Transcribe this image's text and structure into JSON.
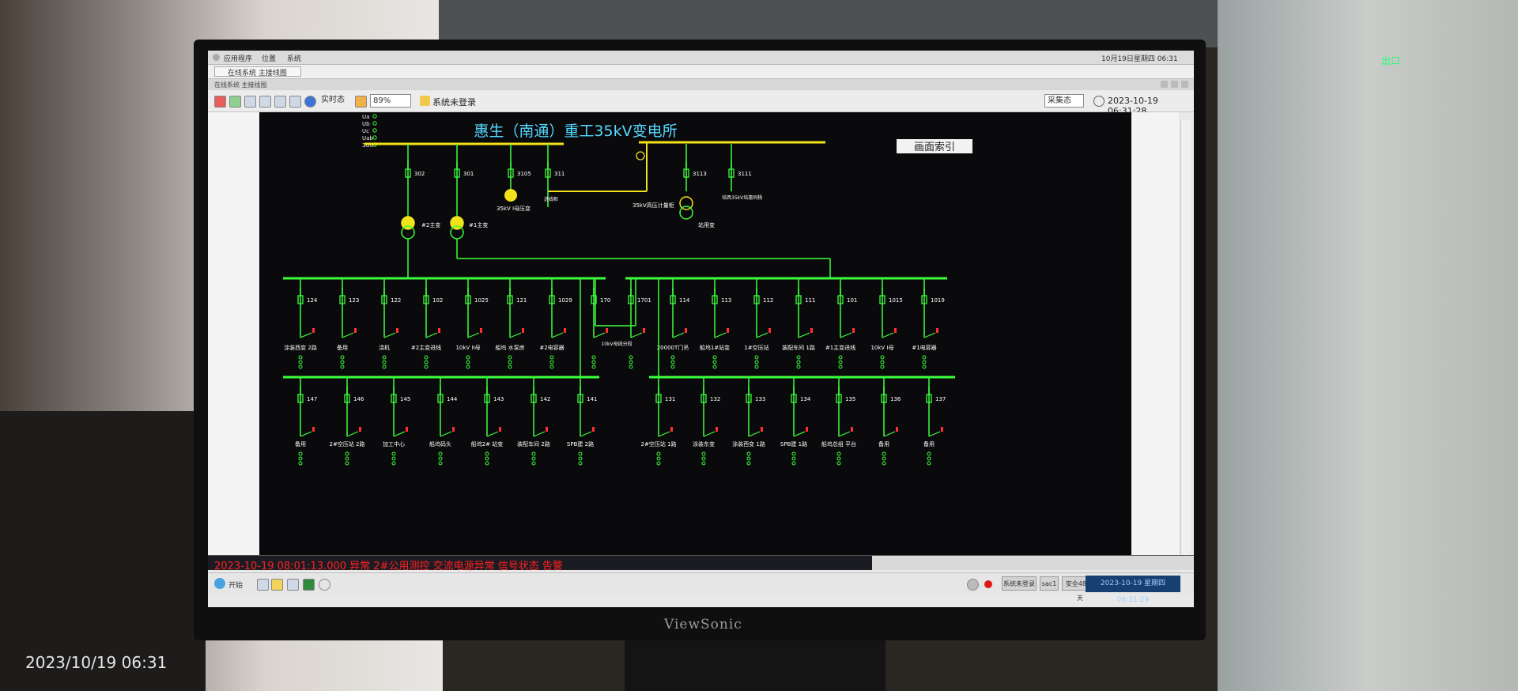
{
  "photo_timestamp": "2023/10/19 06:31",
  "monitor_brand": "ViewSonic",
  "exit_sign": "出口",
  "os_bar": {
    "menu": [
      "应用程序",
      "位置",
      "系统"
    ],
    "clock": "10月19日星期四 06:31"
  },
  "tab_bar": {
    "tab": "在线系统 主接线图"
  },
  "window_title": "在线系统 主接线图",
  "toolbar": {
    "mode": "实时态",
    "zoom": "89%",
    "login_status": "系统未登录",
    "collect_mode": "采集态",
    "datetime": "2023-10-19 06:31:28"
  },
  "diagram": {
    "title": "惠生（南通）重工35kV变电所",
    "index_button": "画面索引",
    "voltage_labels": [
      "Ua",
      "Ub",
      "Uc",
      "Uab",
      "3U0"
    ],
    "hv": {
      "breakers": [
        "302",
        "301",
        "3105",
        "311",
        "3113",
        "3111"
      ],
      "labels": {
        "t2": "#2主变",
        "t1": "#1主变",
        "pt35": "35kV I母压变",
        "feed": "进线柜",
        "meter": "35kV高压计量柜",
        "station": "站用变",
        "line": "培西35kV培惠同杨"
      }
    },
    "bus1_upper": [
      {
        "no": "124",
        "label": "涂装西变 2路"
      },
      {
        "no": "123",
        "label": "备用"
      },
      {
        "no": "122",
        "label": "浇机"
      },
      {
        "no": "102",
        "label": "#2主变进线"
      },
      {
        "no": "1025",
        "label": "10kV II母"
      },
      {
        "no": "121",
        "label": "船坞 水泵房"
      },
      {
        "no": "1029",
        "label": "#2电容器"
      },
      {
        "no": "170",
        "label": ""
      }
    ],
    "bus_tie_label": "10kV母线分段",
    "bus2_upper": [
      {
        "no": "1701",
        "label": ""
      },
      {
        "no": "114",
        "label": "20000T门吊"
      },
      {
        "no": "113",
        "label": "船坞1#站变"
      },
      {
        "no": "112",
        "label": "1#空压站"
      },
      {
        "no": "111",
        "label": "装配车间 1路"
      },
      {
        "no": "101",
        "label": "#1主变进线"
      },
      {
        "no": "1015",
        "label": "10kV I母"
      },
      {
        "no": "1019",
        "label": "#1电容器"
      }
    ],
    "bus1_lower": [
      {
        "no": "147",
        "label": "备用"
      },
      {
        "no": "146",
        "label": "2#空压站 2路"
      },
      {
        "no": "145",
        "label": "加工中心"
      },
      {
        "no": "144",
        "label": "船坞码头"
      },
      {
        "no": "143",
        "label": "船坞2# 站变"
      },
      {
        "no": "142",
        "label": "装配车间 2路"
      },
      {
        "no": "141",
        "label": "SPB建 2路"
      }
    ],
    "bus2_lower": [
      {
        "no": "131",
        "label": "2#空压站 1路"
      },
      {
        "no": "132",
        "label": "涂装东变"
      },
      {
        "no": "133",
        "label": "涂装西变 1路"
      },
      {
        "no": "134",
        "label": "SPB建 1路"
      },
      {
        "no": "135",
        "label": "船坞总组 平台"
      },
      {
        "no": "136",
        "label": "备用"
      },
      {
        "no": "137",
        "label": "备用"
      }
    ]
  },
  "alarm": {
    "text": "2023-10-19 08:01:13.000  异常  2#公用测控  交流电源异常  信号状态  告警"
  },
  "taskbar": {
    "start": "开始",
    "user": "系统未登录",
    "node": "sac1",
    "uptime": "安全4858天",
    "clock": "2023-10-19 星期四 06:31:29"
  },
  "colors": {
    "bus_35kv": "#f2e21a",
    "bus_10kv": "#3cff3c",
    "breaker_closed": "#ff3030",
    "title": "#56d8ff"
  }
}
